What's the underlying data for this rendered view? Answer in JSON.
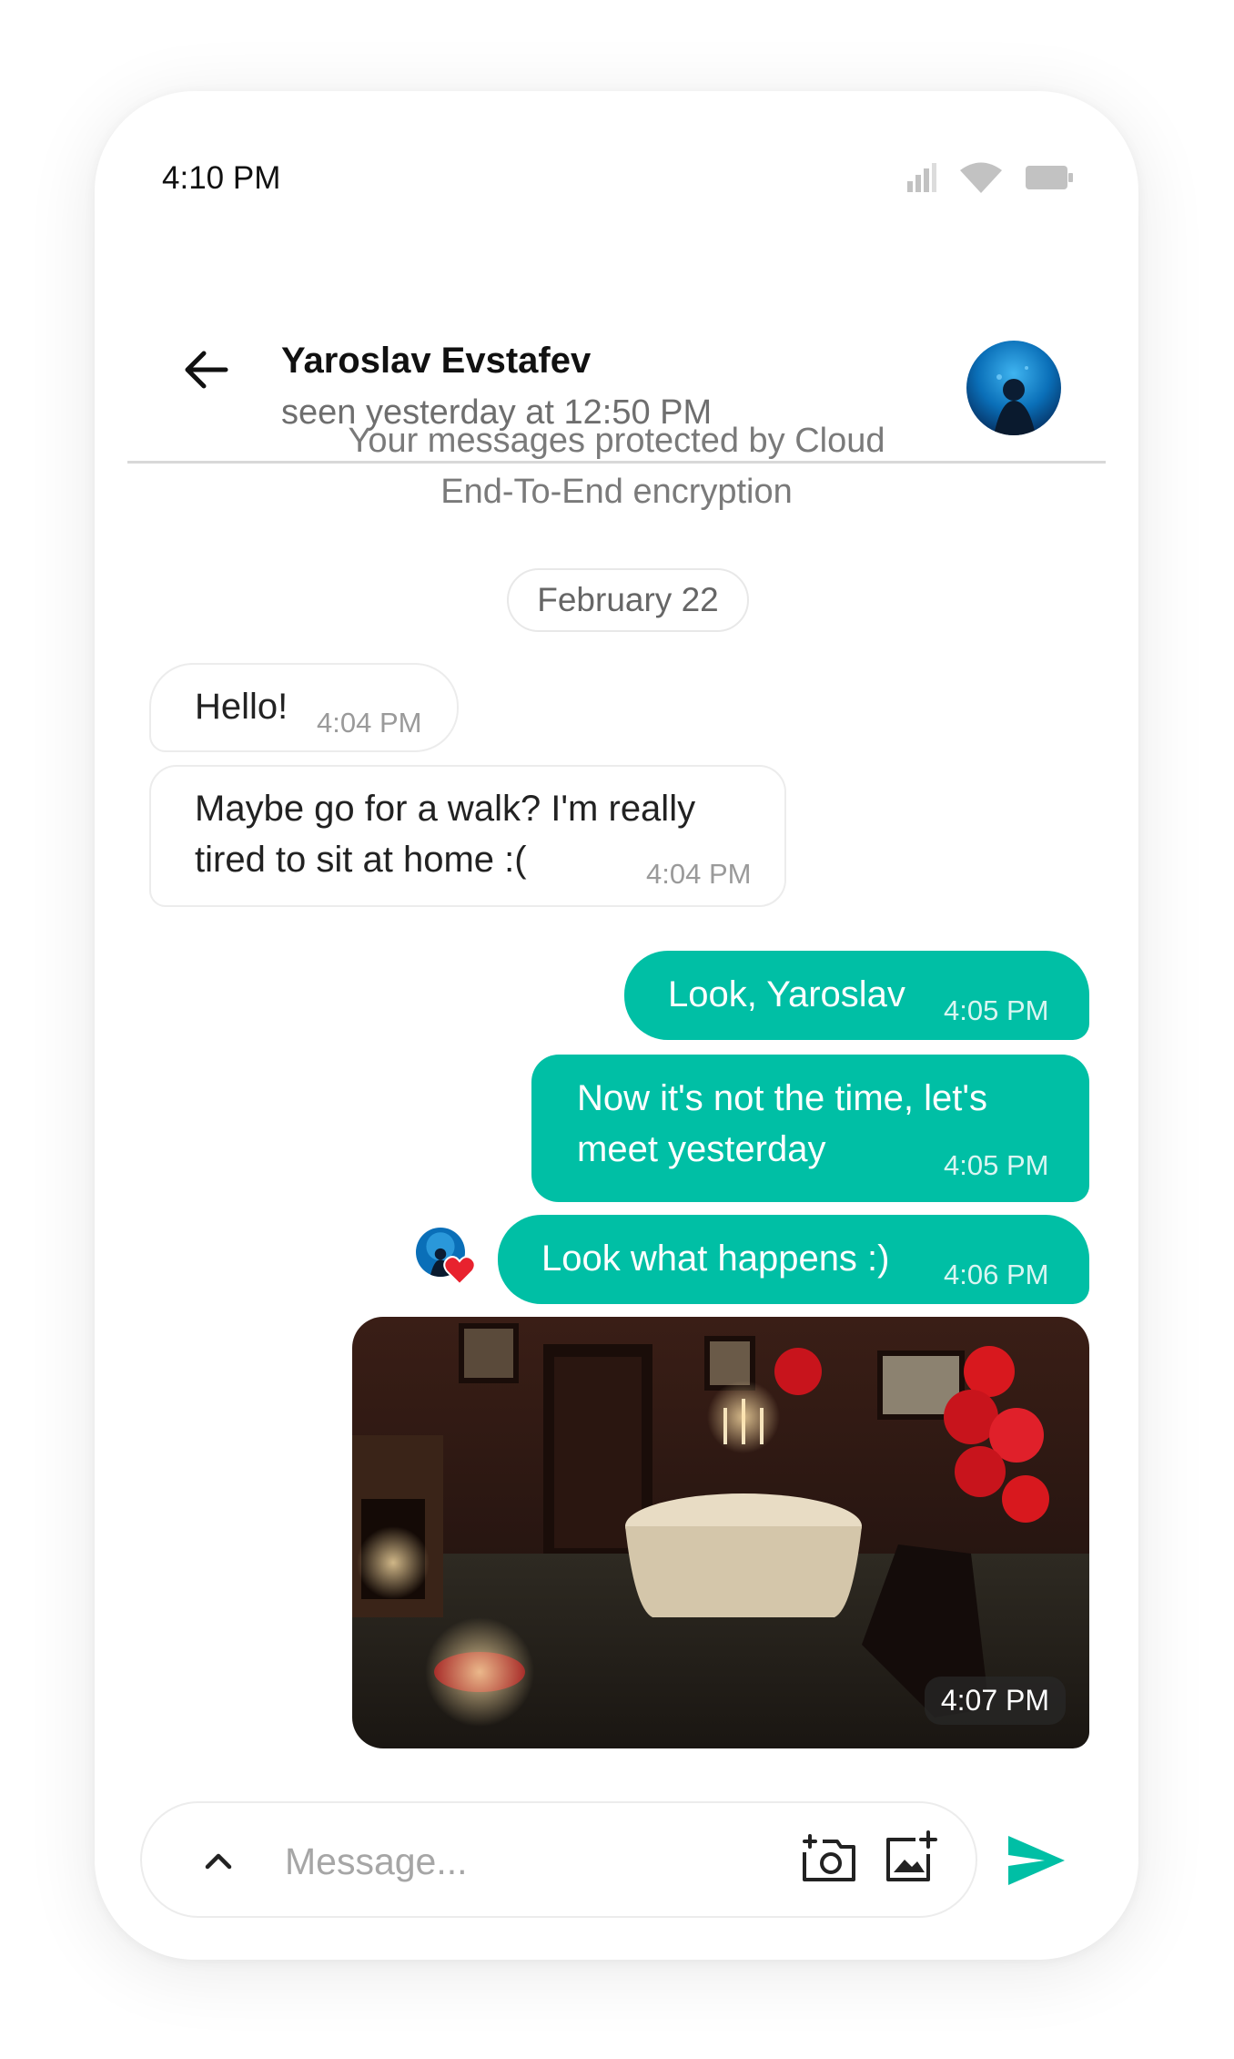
{
  "status_bar": {
    "time": "4:10 PM"
  },
  "header": {
    "contact_name": "Yaroslav Evstafev",
    "last_seen": "seen yesterday at 12:50 PM"
  },
  "encryption_note": "Your messages protected by Cloud End-To-End encryption",
  "date_separator": "February 22",
  "messages": [
    {
      "direction": "incoming",
      "text": "Hello!",
      "time": "4:04 PM"
    },
    {
      "direction": "incoming",
      "text": "Maybe go for a walk? I'm really tired to sit at home :(",
      "time": "4:04 PM"
    },
    {
      "direction": "outgoing",
      "text": "Look, Yaroslav",
      "time": "4:05 PM"
    },
    {
      "direction": "outgoing",
      "text": "Now it's not the time, let's meet yesterday",
      "time": "4:05 PM"
    },
    {
      "direction": "outgoing",
      "text": "Look what happens :)",
      "time": "4:06 PM",
      "reaction": "heart-icon"
    },
    {
      "direction": "outgoing",
      "type": "photo",
      "time": "4:07 PM"
    }
  ],
  "composer": {
    "placeholder": "Message..."
  },
  "colors": {
    "accent": "#00bfa5",
    "reaction": "#e8222e"
  }
}
